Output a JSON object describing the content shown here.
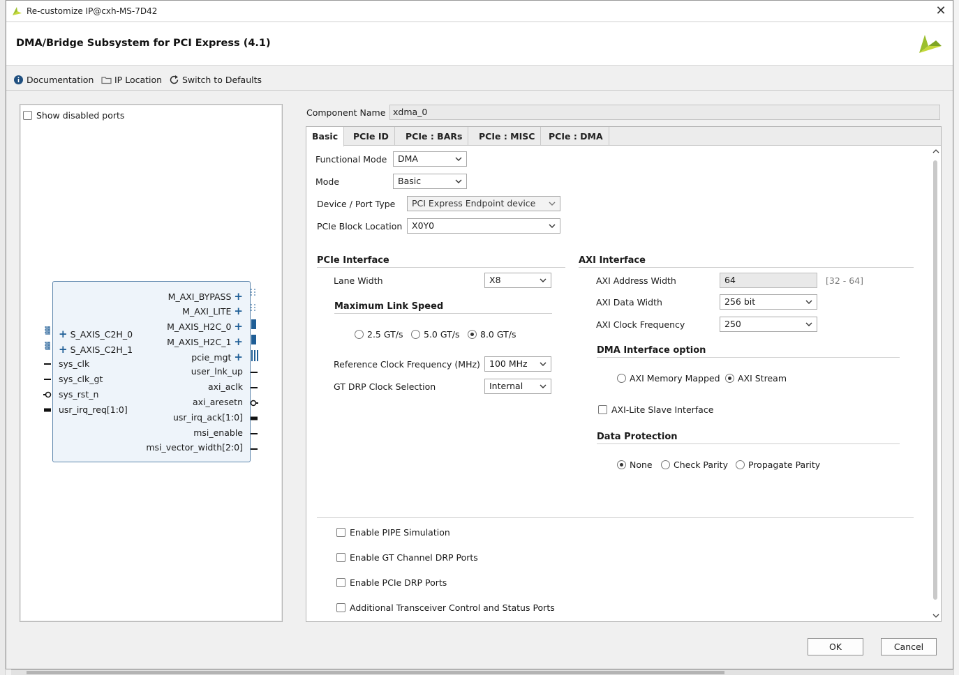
{
  "window": {
    "title": "Re-customize IP@cxh-MS-7D42"
  },
  "header": {
    "title": "DMA/Bridge Subsystem for PCI Express (4.1)"
  },
  "toolbar": {
    "documentation": "Documentation",
    "ip_location": "IP Location",
    "switch_defaults": "Switch to Defaults"
  },
  "preview": {
    "show_disabled_label": "Show disabled ports",
    "right_ports": [
      "M_AXI_BYPASS",
      "M_AXI_LITE",
      "M_AXIS_H2C_0",
      "M_AXIS_H2C_1",
      "pcie_mgt",
      "user_lnk_up",
      "axi_aclk",
      "axi_aresetn",
      "usr_irq_ack[1:0]",
      "msi_enable",
      "msi_vector_width[2:0]"
    ],
    "left_ports": [
      "S_AXIS_C2H_0",
      "S_AXIS_C2H_1",
      "sys_clk",
      "sys_clk_gt",
      "sys_rst_n",
      "usr_irq_req[1:0]"
    ]
  },
  "component": {
    "label": "Component Name",
    "value": "xdma_0"
  },
  "tabs": [
    "Basic",
    "PCIe ID",
    "PCIe : BARs",
    "PCIe : MISC",
    "PCIe : DMA"
  ],
  "basic": {
    "functional_mode": {
      "label": "Functional Mode",
      "value": "DMA"
    },
    "mode": {
      "label": "Mode",
      "value": "Basic"
    },
    "device_port_type": {
      "label": "Device / Port Type",
      "value": "PCI Express Endpoint device"
    },
    "pcie_block_location": {
      "label": "PCIe Block Location",
      "value": "X0Y0"
    }
  },
  "pcie_interface": {
    "title": "PCIe Interface",
    "lane_width": {
      "label": "Lane Width",
      "value": "X8"
    },
    "max_link_speed": {
      "title": "Maximum Link Speed",
      "options": [
        "2.5 GT/s",
        "5.0 GT/s",
        "8.0 GT/s"
      ],
      "selected": "8.0 GT/s"
    },
    "ref_clock": {
      "label": "Reference Clock Frequency (MHz)",
      "value": "100 MHz"
    },
    "gt_drp": {
      "label": "GT DRP Clock Selection",
      "value": "Internal"
    }
  },
  "axi_interface": {
    "title": "AXI Interface",
    "address_width": {
      "label": "AXI Address Width",
      "value": "64",
      "range": "[32 - 64]"
    },
    "data_width": {
      "label": "AXI Data Width",
      "value": "256 bit"
    },
    "clock_freq": {
      "label": "AXI Clock Frequency",
      "value": "250"
    }
  },
  "dma_interface": {
    "title": "DMA Interface option",
    "options": [
      "AXI Memory Mapped",
      "AXI Stream"
    ],
    "selected": "AXI Stream",
    "axi_lite_slave": "AXI-Lite Slave Interface"
  },
  "data_protection": {
    "title": "Data Protection",
    "options": [
      "None",
      "Check Parity",
      "Propagate Parity"
    ],
    "selected": "None"
  },
  "bottom_options": [
    "Enable PIPE Simulation",
    "Enable GT Channel DRP Ports",
    "Enable PCIe DRP Ports",
    "Additional Transceiver Control and Status Ports"
  ],
  "buttons": {
    "ok": "OK",
    "cancel": "Cancel"
  },
  "colors": {
    "accent": "#1f5e96",
    "logo": "#9bbf2e"
  }
}
